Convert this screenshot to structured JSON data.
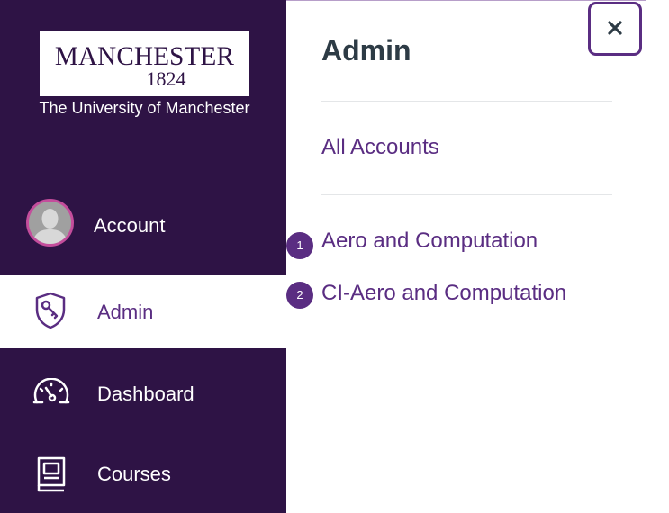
{
  "brand": {
    "logo_name": "MANCHESTER",
    "logo_year": "1824",
    "subtitle": "The University of Manchester"
  },
  "nav": {
    "account": {
      "label": "Account",
      "icon": "avatar"
    },
    "admin": {
      "label": "Admin",
      "icon": "shield-key-icon",
      "active": true
    },
    "dashboard": {
      "label": "Dashboard",
      "icon": "speedometer-icon"
    },
    "courses": {
      "label": "Courses",
      "icon": "book-icon"
    }
  },
  "panel": {
    "title": "Admin",
    "all_accounts": "All Accounts",
    "accounts": [
      {
        "badge": "1",
        "label": "Aero and Computation"
      },
      {
        "badge": "2",
        "label": "CI-Aero and Computation"
      }
    ],
    "close_icon": "close-icon"
  },
  "colors": {
    "sidebar_bg": "#2e1345",
    "accent": "#5a2d82",
    "avatar_ring": "#c44d9c",
    "title_text": "#2d3b45"
  }
}
